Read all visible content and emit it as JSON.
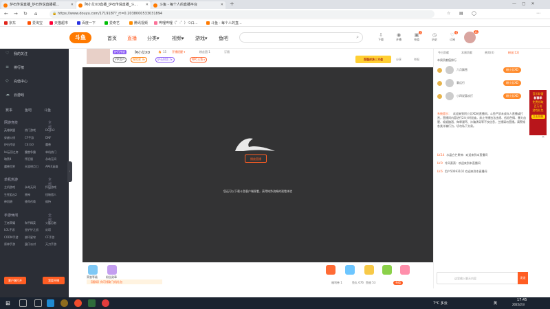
{
  "browser": {
    "tabs": [
      {
        "label": "炉石传说直播_炉石传说直播视..."
      },
      {
        "label": "阿小艾XD直播_炉石传说直播_斗..."
      },
      {
        "label": "斗鱼 - 每个人的直播平台"
      }
    ],
    "url": "https://www.douyu.com/1719187?_rt=0.2038000533031894",
    "bookmarks": [
      {
        "label": "京东",
        "color": "#e1251b"
      },
      {
        "label": "爱淘宝",
        "color": "#ff5000"
      },
      {
        "label": "天猫超市",
        "color": "#ff0036"
      },
      {
        "label": "百度一下",
        "color": "#2932e1"
      },
      {
        "label": "爱奇艺",
        "color": "#00be06"
      },
      {
        "label": "腾讯视频",
        "color": "#ff8c00"
      },
      {
        "label": "哔哩哔哩（゜-゜）つロ...",
        "color": "#fb7299"
      },
      {
        "label": "斗鱼 - 每个人的直...",
        "color": "#ff7a00"
      }
    ]
  },
  "site": {
    "logo": "斗鱼",
    "nav": [
      {
        "label": "首页",
        "active": false
      },
      {
        "label": "直播",
        "active": true
      },
      {
        "label": "分类▾",
        "active": false
      },
      {
        "label": "视频▾",
        "active": false
      },
      {
        "label": "游戏▾",
        "active": false
      },
      {
        "label": "鱼吧",
        "active": false
      }
    ],
    "header_icons": [
      {
        "label": "下载",
        "glyph": "⇩",
        "badge": ""
      },
      {
        "label": "开播",
        "glyph": "◉",
        "badge": ""
      },
      {
        "label": "充值",
        "glyph": "▣",
        "badge": "4"
      },
      {
        "label": "历史",
        "glyph": "◷",
        "badge": ""
      },
      {
        "label": "订阅",
        "glyph": "♡",
        "badge": "6"
      }
    ],
    "avatar_badge": "11"
  },
  "sidebar": {
    "items": [
      {
        "icon": "♡",
        "label": "我的关注"
      },
      {
        "icon": "≡",
        "label": "排行榜"
      },
      {
        "icon": "◇",
        "label": "充值中心"
      },
      {
        "icon": "☁",
        "label": "云游戏"
      }
    ],
    "quick": [
      "赛事",
      "鱼吧",
      "斗鱼"
    ],
    "sections": [
      {
        "title": "网游竞技",
        "more": "全部 >",
        "cats": [
          "英雄联盟",
          "热门游戏",
          "DOTA2",
          "穿越火线",
          "CF手游",
          "DNF",
          "炉石传说",
          "CS:GO",
          "魔兽",
          "lol云顶之弈",
          "魔兽争霸",
          "单机热门",
          "暗黑4",
          "怀旧服",
          "永劫无间",
          "魔兽世界",
          "天涯明月刀",
          "APEX英雄"
        ]
      },
      {
        "title": "单机热游",
        "more": "全部 >",
        "cats": [
          "主机游戏",
          "永劫无间",
          "怀旧游戏",
          "生死狙击2",
          "原神",
          "怪物猎人",
          "神回避",
          "使命召唤",
          "维持"
        ]
      },
      {
        "title": "手游休闲",
        "more": "全部 >",
        "cats": [
          "王者荣耀",
          "和平精英",
          "火影忍者",
          "LOL手游",
          "金铲铲之战",
          "幻塔",
          "CODM手游",
          "崩坏星穹",
          "CF手游",
          "原神手游",
          "蛋仔派对",
          "天刀手游"
        ]
      }
    ],
    "btn_left": "客户端打开",
    "btn_right": "我要开播"
  },
  "stream": {
    "title": "阿小艾XD",
    "heat": "15",
    "alert_text": "开播提醒 ▾",
    "fans": "粉丝团 1",
    "subscribe": "订阅",
    "category": "炉石传说",
    "level_tags": [
      "VIP用户",
      "探险家 3▸",
      "炉石财团 2▸",
      "NPC斗鱼 ▸"
    ],
    "event_banner": "百强对决 | 大会",
    "share": "分享",
    "report": "举报",
    "open_btn": "播放直播",
    "tip": "您还可以下载斗鱼客户端观看，获得纯净流畅的观看体验",
    "bottom_tags": [
      "荣誉等级",
      "粉丝勋章"
    ],
    "bottom_hint": "【通知】你可领取飞机礼包",
    "stats": [
      "福利券 1",
      "鱼丸 676",
      "鱼翅 53",
      "充值"
    ]
  },
  "right_panel": {
    "tabs": [
      {
        "label": "今日贡献",
        "active": false
      },
      {
        "label": "本周贡献",
        "active": false
      },
      {
        "label": "贵宾(4)",
        "active": false
      },
      {
        "label": "粉丝(12)",
        "active": true
      }
    ],
    "rank_title": "本周贡献值排行",
    "ranks": [
      {
        "name": "六月飘雪",
        "tag": "粉小艾XD"
      },
      {
        "name": "雾远行",
        "tag": "粉小艾XD"
      },
      {
        "name": "小四说喜欢打",
        "tag": "粉小艾XD"
      }
    ],
    "chat": [
      {
        "lv": "系统提示：",
        "text": "欢迎来到阿小艾XD的直播间，斗鱼严禁未成年人直播或打赏，直播间内容进行24小时巡查。禁止传播违法违规、低俗色情、暴力血腥、吸烟酗酒、侮辱谩骂、诈骗诱导等不良信息，主播请勿直播。请警惕各类诈骗行为，切勿私下交易。"
      },
      {
        "lv": "LV.14",
        "text": "水晶白芒果神：欢迎来到本直播间"
      },
      {
        "lv": "LV.9",
        "text": "冷风萧萧：欢迎来到本直播间"
      },
      {
        "lv": "LV.6",
        "text": "用户50693102 欢迎来到本直播间"
      }
    ],
    "input_placeholder": "这里输入聊天内容",
    "send": "发送"
  },
  "promo": {
    "line1": "音乐联盟",
    "line2": "新春季",
    "line3": "免费领取",
    "line4": "百万份",
    "line5": "游戏礼包",
    "btn": "点击领取"
  },
  "taskbar": {
    "weather": "7°C 多云",
    "time": "17:45",
    "date": "2022/2/3",
    "lang": "英"
  }
}
